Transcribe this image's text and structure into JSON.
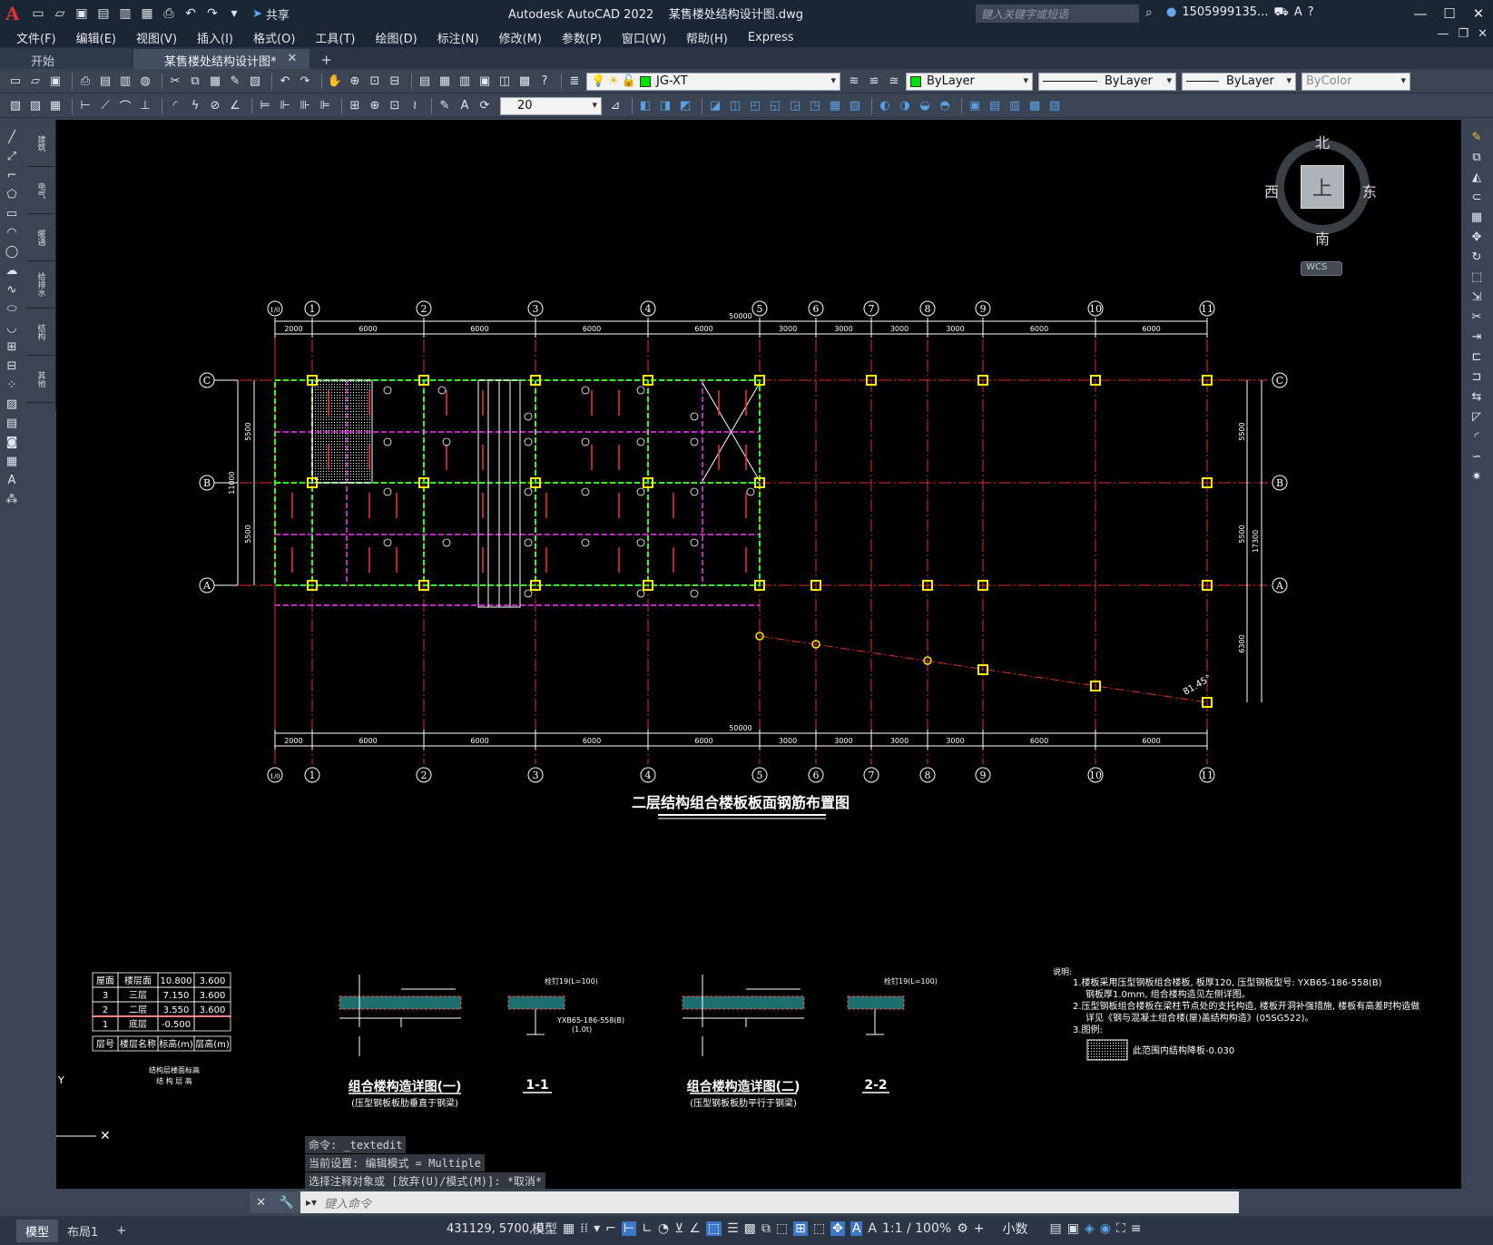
{
  "app": {
    "title": "Autodesk AutoCAD 2022",
    "filename": "某售楼处结构设计图.dwg",
    "search_placeholder": "键入关键字或短语",
    "user": "1505999135...",
    "share_label": "共享"
  },
  "menu": [
    "文件(F)",
    "编辑(E)",
    "视图(V)",
    "插入(I)",
    "格式(O)",
    "工具(T)",
    "绘图(D)",
    "标注(N)",
    "修改(M)",
    "参数(P)",
    "窗口(W)",
    "帮助(H)",
    "Express"
  ],
  "tabs": {
    "start": "开始",
    "active": "某售楼处结构设计图*"
  },
  "toolbar": {
    "layer": "JG-XT",
    "color": "ByLayer",
    "linetype": "ByLayer",
    "lineweight": "ByLayer",
    "plotstyle": "ByColor",
    "dimscale": "20"
  },
  "viewcube": {
    "north": "北",
    "south": "南",
    "east": "东",
    "west": "西",
    "face": "上",
    "wcs": "WCS"
  },
  "drawing": {
    "title": "二层结构组合楼板板面钢筋布置图",
    "top_axes": [
      "1/0",
      "1",
      "2",
      "3",
      "4",
      "5",
      "6",
      "7",
      "8",
      "9",
      "10",
      "11"
    ],
    "dims": [
      "2000",
      "6000",
      "6000",
      "6000",
      "6000",
      "3000",
      "3000",
      "3000",
      "3000",
      "6000",
      "6000"
    ],
    "total": "50000",
    "rows": [
      "C",
      "B",
      "A"
    ],
    "vdims_left": [
      "5500",
      "5500"
    ],
    "vdim_left_total": "11000",
    "vdims_right": [
      "5500",
      "5500",
      "6300"
    ],
    "vdim_right_total": "17300",
    "angle": "81.45°"
  },
  "level_table": {
    "rows": [
      [
        "屋面",
        "楼层面",
        "10.800",
        "3.600"
      ],
      [
        "3",
        "三层",
        "7.150",
        "3.600"
      ],
      [
        "2",
        "二层",
        "3.550",
        "3.600"
      ],
      [
        "1",
        "底层",
        "-0.500",
        ""
      ],
      [
        "层号",
        "楼层名称",
        "标高(m)",
        "层高(m)"
      ]
    ],
    "caption1": "结构层楼面标高",
    "caption2": "结 构 层 高"
  },
  "details": {
    "d1_title": "组合楼构造详图(一)",
    "d1_sub": "(压型钢板板肋垂直于钢梁)",
    "s11": "1-1",
    "d2_title": "组合楼构造详图(二)",
    "d2_sub": "(压型钢板板肋平行于钢梁)",
    "s22": "2-2",
    "stud": "栓钉19(L=100)",
    "deck": "YXB65-186-558(B)",
    "deck_t": "(1.0t)"
  },
  "notes": {
    "head": "说明:",
    "n1": "1.楼板采用压型钢板组合楼板, 板厚120, 压型钢板型号: YXB65-186-558(B)",
    "n1b": "钢板厚1.0mm, 组合楼构造见左侧详图。",
    "n2": "2.压型钢板组合楼板在梁柱节点处的支托构造, 楼板开洞补强措施, 楼板有高差时构造做",
    "n2b": "详见《钢与混凝土组合楼(屋)盖结构构造》(05SG522)。",
    "n3": "3.图例:",
    "legend": "此范围内结构降板-0.030"
  },
  "command": {
    "h1": "命令: _textedit",
    "h2": "当前设置: 编辑模式 = Multiple",
    "h3": "选择注释对象或 [放弃(U)/模式(M)]: *取消*",
    "placeholder": "键入命令"
  },
  "status": {
    "model_tab": "模型",
    "layout_tab": "布局1",
    "coords": "431129, 5700, 0",
    "model": "模型",
    "scale": "1:1 / 100%",
    "units": "小数"
  }
}
